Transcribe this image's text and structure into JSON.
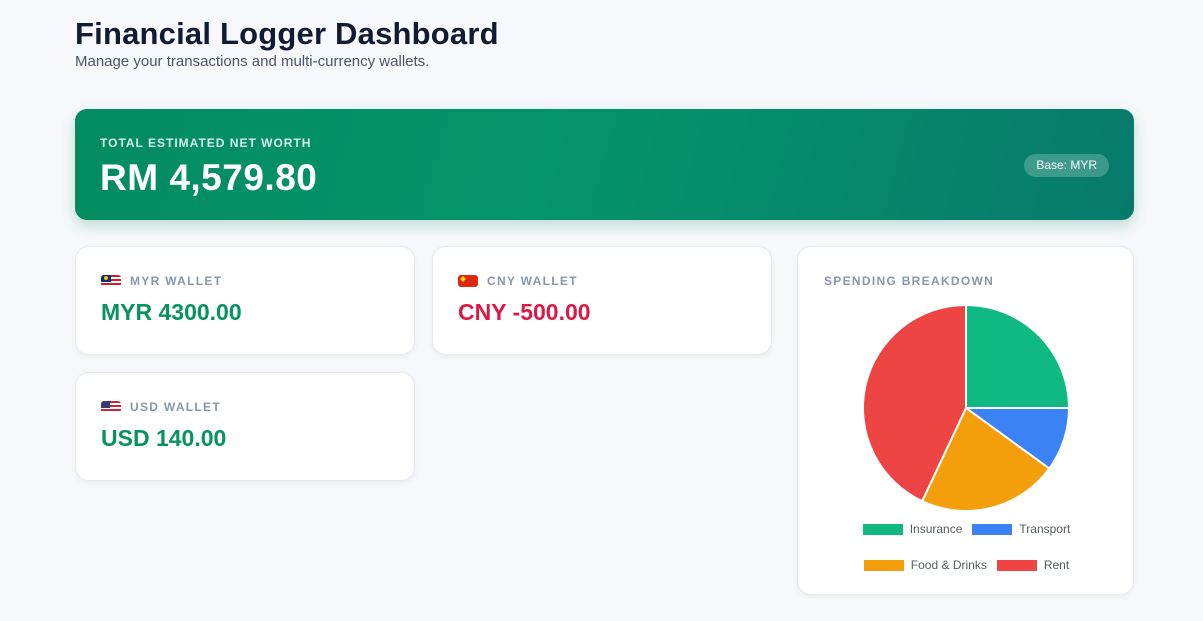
{
  "header": {
    "title": "Financial Logger Dashboard",
    "subtitle": "Manage your transactions and multi-currency wallets."
  },
  "net_worth": {
    "label": "TOTAL ESTIMATED NET WORTH",
    "value": "RM 4,579.80",
    "base_badge": "Base: MYR"
  },
  "wallets": [
    {
      "label": "MYR WALLET",
      "amount": "MYR 4300.00",
      "flag_icon": "malaysia-flag-icon"
    },
    {
      "label": "CNY WALLET",
      "amount": "CNY -500.00",
      "flag_icon": "china-flag-icon"
    },
    {
      "label": "USD WALLET",
      "amount": "USD 140.00",
      "flag_icon": "us-flag-icon"
    }
  ],
  "colors": {
    "positive": "#07925f",
    "negative": "#dc1845",
    "accent": "#059669"
  },
  "chart_data": {
    "type": "pie",
    "title": "SPENDING BREAKDOWN",
    "categories": [
      "Insurance",
      "Transport",
      "Food & Drinks",
      "Rent"
    ],
    "values": [
      25,
      10,
      22,
      43
    ],
    "colors": [
      "#10b981",
      "#3b82f6",
      "#f59e0b",
      "#ef4444"
    ],
    "legend_position": "bottom"
  }
}
